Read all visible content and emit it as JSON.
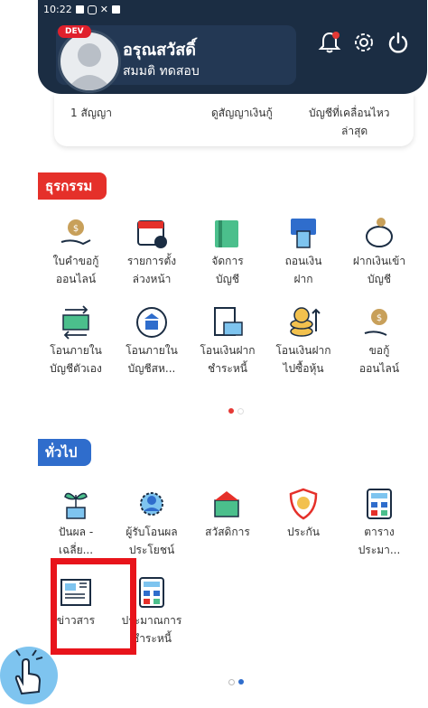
{
  "status_bar": {
    "time": "10:22"
  },
  "header": {
    "dev_badge": "DEV",
    "user_name": "อรุณสวัสดิ์",
    "user_sub": "สมมติ ทดสอบ",
    "icons": [
      "bell-icon",
      "gear-icon",
      "power-icon"
    ]
  },
  "summary_card": {
    "contracts": "1 สัญญา",
    "view_loans": "ดูสัญญาเงินกู้",
    "recent_line1": "บัญชีที่เคลื่อนไหว",
    "recent_line2": "ล่าสุด"
  },
  "sections": [
    {
      "title": "ธุรกรรม",
      "color": "#e5302a"
    },
    {
      "title": "ทั่วไป",
      "color": "#2f6dcc"
    }
  ],
  "transactions": [
    {
      "l1": "ใบคำขอกู้",
      "l2": "ออนไลน์",
      "icon": "loan-request-icon"
    },
    {
      "l1": "รายการตั้ง",
      "l2": "ล่วงหน้า",
      "icon": "calendar-icon"
    },
    {
      "l1": "จัดการ",
      "l2": "บัญชี",
      "icon": "passbook-icon"
    },
    {
      "l1": "ถอนเงิน",
      "l2": "ฝาก",
      "icon": "atm-withdraw-icon"
    },
    {
      "l1": "ฝากเงินเข้า",
      "l2": "บัญชี",
      "icon": "piggy-bank-icon"
    },
    {
      "l1": "โอนภายใน",
      "l2": "บัญชีตัวเอง",
      "icon": "transfer-own-icon"
    },
    {
      "l1": "โอนภายใน",
      "l2": "บัญชีสห...",
      "icon": "bank-transfer-icon"
    },
    {
      "l1": "โอนเงินฝาก",
      "l2": "ชำระหนี้",
      "icon": "deposit-pay-icon"
    },
    {
      "l1": "โอนเงินฝาก",
      "l2": "ไปซื้อหุ้น",
      "icon": "buy-shares-icon"
    },
    {
      "l1": "ขอกู้",
      "l2": "ออนไลน์",
      "icon": "online-loan-icon"
    }
  ],
  "general": [
    {
      "l1": "ปันผล -",
      "l2": "เฉลี่ย...",
      "icon": "dividend-plant-icon"
    },
    {
      "l1": "ผู้รับโอนผล",
      "l2": "ประโยชน์",
      "icon": "beneficiary-icon"
    },
    {
      "l1": "สวัสดิการ",
      "l2": "",
      "icon": "welfare-icon"
    },
    {
      "l1": "ประกัน",
      "l2": "",
      "icon": "insurance-shield-icon"
    },
    {
      "l1": "ตาราง",
      "l2": "ประมา...",
      "icon": "calculator-icon"
    },
    {
      "l1": "ข่าวสาร",
      "l2": "",
      "icon": "news-icon"
    },
    {
      "l1": "ประมาณการ",
      "l2": "ชำระหนี้",
      "icon": "debt-calculator-icon"
    }
  ],
  "colors": {
    "header": "#1b2d43",
    "highlight": "#e8141b",
    "dot_active": "#e53935",
    "dot_blue": "#2f6dcc"
  }
}
